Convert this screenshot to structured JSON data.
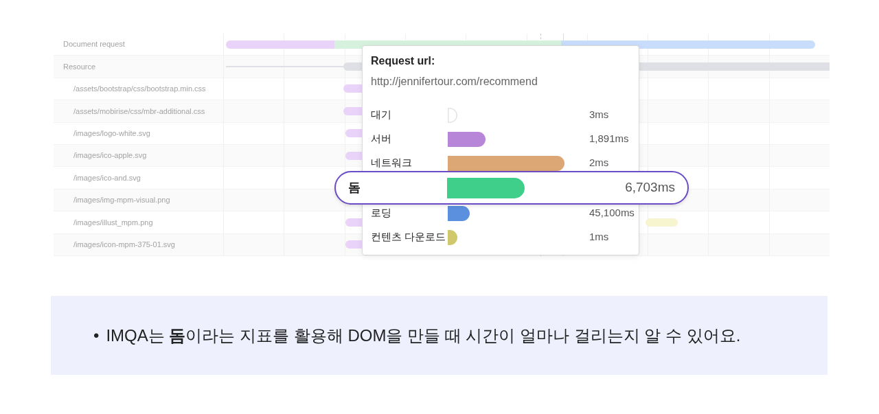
{
  "waterfall": {
    "rows": [
      {
        "label": "Document request"
      },
      {
        "label": "Resource",
        "children": [
          {
            "label": "/assets/bootstrap/css/bootstrap.min.css"
          },
          {
            "label": "/assets/mobirise/css/mbr-additional.css"
          },
          {
            "label": "/images/logo-white.svg"
          },
          {
            "label": "/images/ico-apple.svg"
          },
          {
            "label": "/images/ico-and.svg"
          },
          {
            "label": "/images/img-mpm-visual.png"
          },
          {
            "label": "/images/illust_mpm.png"
          },
          {
            "label": "/images/icon-mpm-375-01.svg"
          }
        ]
      }
    ]
  },
  "tooltip": {
    "title": "Request url:",
    "url": "http://jennifertour.com/recommend",
    "timings": [
      {
        "label": "대기",
        "value": "3ms",
        "color": "#ffffff",
        "highlighted": false
      },
      {
        "label": "서버",
        "value": "1,891ms",
        "color": "#b886d8",
        "highlighted": false
      },
      {
        "label": "네트워크",
        "value": "2ms",
        "color": "#dca774",
        "highlighted": false
      },
      {
        "label": "돔",
        "value": "6,703ms",
        "color": "#3fcf8b",
        "highlighted": true
      },
      {
        "label": "로딩",
        "value": "45,100ms",
        "color": "#5b90de",
        "highlighted": false
      },
      {
        "label": "컨텐츠 다운로드",
        "value": "1ms",
        "color": "#d0c86c",
        "highlighted": false
      }
    ]
  },
  "caption": {
    "bullet": "•",
    "text": "IMQA는 **돔**이라는 지표를 활용해 DOM을 만들 때 시간이 얼마나 걸리는지 알 수 있어요."
  }
}
